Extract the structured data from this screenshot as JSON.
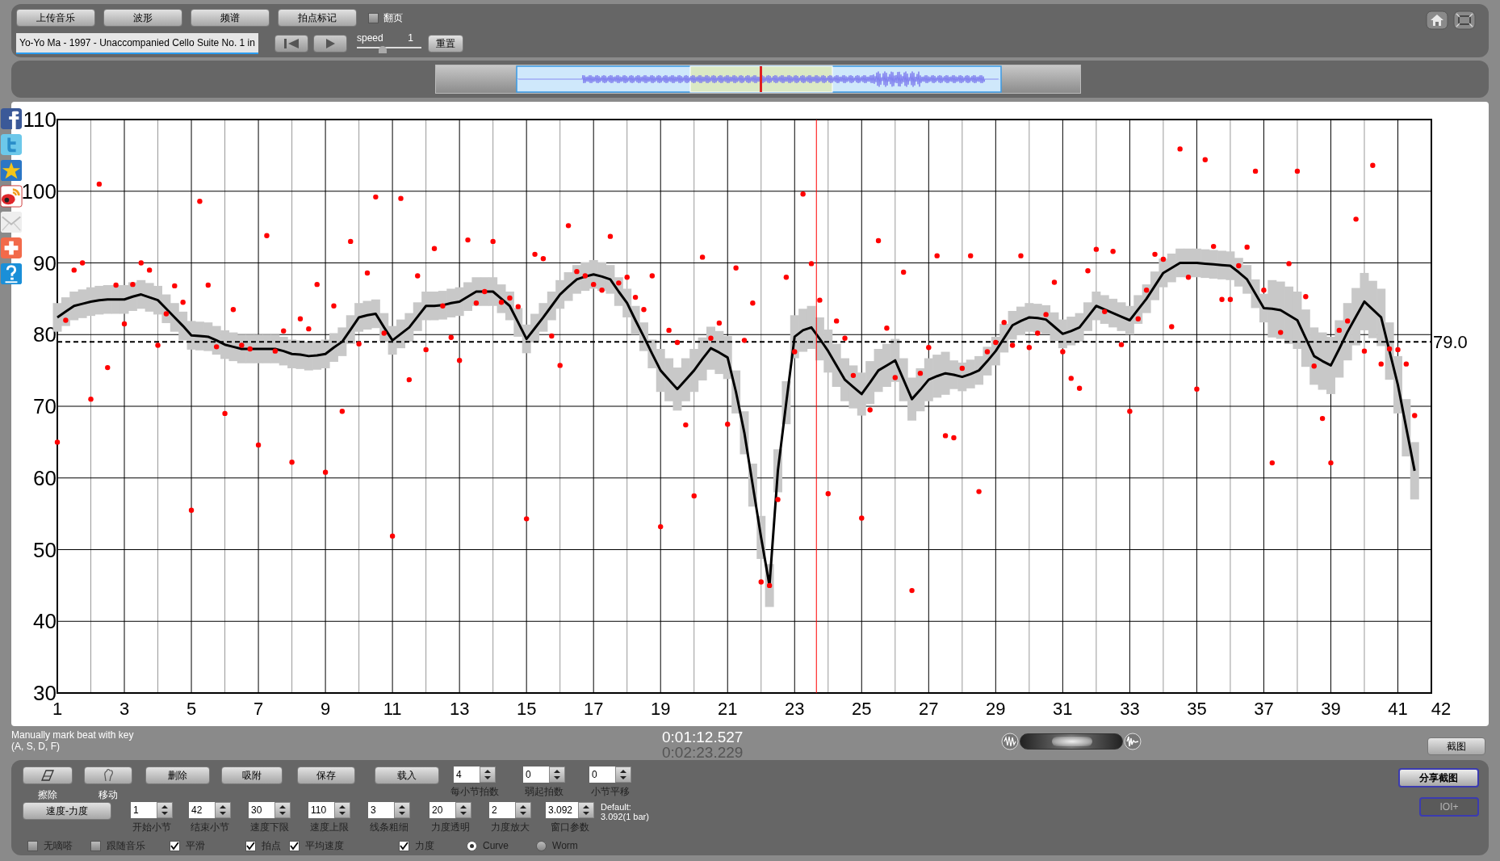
{
  "toolbar": {
    "buttons": [
      "上传音乐",
      "波形",
      "频谱",
      "拍点标记"
    ],
    "page_flip": {
      "label": "翻页",
      "checked": false
    }
  },
  "track": {
    "title": "Yo-Yo Ma - 1997 - Unaccompanied Cello Suite No. 1 in",
    "speed_label": "speed",
    "speed_value": "1",
    "level": 0.4,
    "reset": "重置"
  },
  "chart": {
    "chart_data": {
      "type": "scatter",
      "grid": true,
      "xlim": [
        1,
        42
      ],
      "ylim": [
        30,
        110
      ],
      "xticks": [
        1,
        3,
        5,
        7,
        9,
        11,
        13,
        15,
        17,
        19,
        21,
        23,
        25,
        27,
        29,
        31,
        33,
        35,
        37,
        39,
        41,
        42
      ],
      "yticks": [
        30,
        40,
        50,
        60,
        70,
        80,
        90,
        100,
        110
      ],
      "x": [
        1,
        1.25,
        1.5,
        1.75,
        2,
        2.25,
        2.5,
        2.75,
        3,
        3.25,
        3.5,
        3.75,
        4,
        4.25,
        4.5,
        4.75,
        5,
        5.25,
        5.5,
        5.75,
        6,
        6.25,
        6.5,
        6.75,
        7,
        7.25,
        7.5,
        7.75,
        8,
        8.25,
        8.5,
        8.75,
        9,
        9.25,
        9.5,
        9.75,
        10,
        10.25,
        10.5,
        10.75,
        11,
        11.25,
        11.5,
        11.75,
        12,
        12.25,
        12.5,
        12.75,
        13,
        13.25,
        13.5,
        13.75,
        14,
        14.25,
        14.5,
        14.75,
        15,
        15.25,
        15.5,
        15.75,
        16,
        16.25,
        16.5,
        16.75,
        17,
        17.25,
        17.5,
        17.75,
        18,
        18.25,
        18.5,
        18.75,
        19,
        19.25,
        19.5,
        19.75,
        20,
        20.25,
        20.5,
        20.75,
        21,
        21.25,
        21.5,
        21.75,
        22,
        22.25,
        22.5,
        22.75,
        23,
        23.25,
        23.5,
        23.75,
        24,
        24.25,
        24.5,
        24.75,
        25,
        25.25,
        25.5,
        25.75,
        26,
        26.25,
        26.5,
        26.75,
        27,
        27.25,
        27.5,
        27.75,
        28,
        28.25,
        28.5,
        28.75,
        29,
        29.25,
        29.5,
        29.75,
        30,
        30.25,
        30.5,
        30.75,
        31,
        31.25,
        31.5,
        31.75,
        32,
        32.25,
        32.5,
        32.75,
        33,
        33.25,
        33.5,
        33.75,
        34,
        34.25,
        34.5,
        34.75,
        35,
        35.25,
        35.5,
        35.75,
        36,
        36.25,
        36.5,
        36.75,
        37,
        37.25,
        37.5,
        37.75,
        38,
        38.25,
        38.5,
        38.75,
        39,
        39.25,
        39.5,
        39.75,
        40,
        40.25,
        40.5,
        40.75,
        41,
        41.25,
        41.5
      ],
      "series": [
        {
          "color": "#ff0000",
          "values": [
            65,
            82,
            89,
            90,
            71,
            101,
            75.4,
            86.9,
            81.5,
            87,
            90,
            89,
            78.5,
            82.9,
            86.8,
            84.5,
            55.5,
            98.6,
            86.9,
            78.3,
            69,
            83.5,
            78.5,
            78,
            64.6,
            93.8,
            77.7,
            80.5,
            62.2,
            82.2,
            80.8,
            87,
            60.8,
            84,
            69.3,
            93,
            78.7,
            88.6,
            99.2,
            80.2,
            51.9,
            99,
            73.7,
            88.2,
            77.9,
            92,
            84,
            79.6,
            76.4,
            93.2,
            84.4,
            86,
            93,
            84.5,
            85.1,
            83.9,
            54.3,
            91.2,
            90.6,
            79.8,
            75.7,
            95.2,
            88.8,
            88.2,
            87,
            86.2,
            93.7,
            87.2,
            88,
            85.2,
            83.5,
            88.2,
            53.2,
            80.6,
            78.9,
            67.4,
            57.5,
            90.8,
            79.5,
            81.6,
            67.5,
            89.3,
            79.2,
            84.4,
            45.5,
            45,
            57,
            88,
            77.6,
            99.6,
            89.9,
            84.8,
            57.8,
            81.9,
            79.5,
            74.3,
            54.4,
            69.5,
            93.1,
            80.9,
            74,
            88.7,
            44.3,
            74.6,
            78.2,
            91,
            65.9,
            65.6,
            75.3,
            91,
            58.1,
            77.6,
            78.9,
            81.7,
            78.5,
            91,
            78.2,
            80.2,
            82.8,
            87.3,
            77.6,
            73.9,
            72.5,
            88.9,
            91.9,
            83.2,
            91.6,
            78.6,
            69.3,
            82.2,
            86.2,
            91.2,
            90.5,
            81.1,
            105.9,
            88,
            72.4,
            104.4,
            92.3,
            84.9,
            84.9,
            89.6,
            92.2,
            102.8,
            86.2,
            62.1,
            80.3,
            89.9,
            102.8,
            85.3,
            75.6,
            68.3,
            62.1,
            80.6,
            81.9,
            96.1,
            77.7,
            103.6,
            75.9,
            78,
            77.9,
            75.9,
            68.7
          ]
        },
        {
          "type": "line",
          "color": "#000000",
          "errors": [
            2,
            2,
            2,
            2,
            2,
            2,
            2,
            2,
            2,
            2,
            2,
            2,
            2,
            2,
            2,
            2,
            2,
            2,
            2,
            2,
            2,
            2,
            2,
            2,
            2,
            2,
            2,
            2,
            2,
            2,
            2,
            2,
            2,
            2,
            2,
            2,
            2,
            2,
            2,
            2,
            2,
            2,
            2,
            2,
            2,
            2,
            2,
            2,
            2,
            2,
            2,
            2,
            2,
            2,
            2,
            2,
            2,
            2,
            2,
            2,
            2,
            2,
            2,
            2,
            2,
            2,
            2,
            2,
            2,
            2,
            2,
            2,
            3,
            3,
            3,
            3,
            3,
            3,
            3,
            3,
            3,
            3,
            3,
            3,
            3,
            3,
            3,
            3,
            3,
            3,
            3,
            3,
            3,
            3,
            3,
            3,
            3,
            3,
            3,
            3,
            3,
            3,
            3,
            3,
            3,
            3,
            3,
            2,
            2,
            2,
            2,
            2,
            2,
            2,
            2,
            2,
            2,
            2,
            2,
            2,
            2,
            2,
            2,
            2,
            2,
            2,
            2,
            2,
            2,
            2,
            2,
            2,
            2,
            2,
            2,
            2,
            2,
            2,
            2,
            2,
            2,
            2,
            2,
            2,
            2,
            4,
            4,
            4,
            4,
            4,
            4,
            4,
            4,
            4,
            4,
            4,
            4,
            4,
            4,
            4,
            4,
            4,
            4
          ],
          "values": [
            82.4,
            83.2,
            84,
            84.3,
            84.6,
            84.8,
            84.9,
            84.9,
            84.9,
            85.3,
            85.6,
            85.2,
            84.8,
            83.6,
            82.4,
            81.2,
            79.9,
            79.8,
            79.7,
            79.2,
            78.6,
            78.3,
            78,
            78,
            78,
            78,
            78,
            77.7,
            77.3,
            77.2,
            77,
            77.1,
            77.3,
            78.2,
            79,
            80.7,
            82.4,
            82.7,
            82.9,
            81,
            79.2,
            80.1,
            81,
            82.5,
            84,
            84,
            84.1,
            84.4,
            84.6,
            85.3,
            86,
            86,
            86,
            85,
            84,
            81.7,
            79.4,
            80.9,
            82.4,
            84,
            85.6,
            86.7,
            87.7,
            88.1,
            88.4,
            88.1,
            87.7,
            86,
            84.4,
            82,
            79.7,
            77.3,
            75,
            73.7,
            72.4,
            73.7,
            75,
            76.6,
            78.1,
            77.5,
            76.8,
            72,
            66.3,
            59,
            51.7,
            45,
            61,
            70.5,
            79.7,
            80.6,
            81,
            79.4,
            77.7,
            75.7,
            73.7,
            72.7,
            71.7,
            73.3,
            75,
            75.7,
            76.4,
            73.7,
            71,
            72.3,
            73.7,
            74.2,
            74.6,
            74.4,
            74.1,
            74.5,
            75,
            76.3,
            77.7,
            79.5,
            81.3,
            81.9,
            82.4,
            82.3,
            82.1,
            81.1,
            80.1,
            80.5,
            81,
            82.5,
            84,
            83.5,
            83,
            82.5,
            82,
            83.5,
            85,
            86.8,
            88.6,
            89.3,
            90,
            90,
            90,
            89.9,
            89.8,
            89.7,
            89.6,
            88.7,
            87.7,
            85.7,
            83.7,
            83.6,
            83.4,
            82.7,
            82,
            79.5,
            77,
            76.3,
            75.7,
            78,
            80.4,
            82.5,
            84.6,
            83.5,
            82.4,
            77.7,
            73,
            67,
            61
          ]
        }
      ],
      "ref_lines": [
        {
          "axis": "y",
          "value": 79,
          "label": "79.0"
        },
        {
          "axis": "x",
          "value": 23.65,
          "color": "#ff0000"
        }
      ]
    }
  },
  "zoom": {
    "level": 0.5
  },
  "hint": [
    "Manually mark beat with key",
    "(A, S, D, F)"
  ],
  "times": {
    "current": "0:01:12.527",
    "total": "0:02:23.229"
  },
  "screenshot_button": "截图",
  "tools": [
    {
      "kind": "eraser",
      "label": "擦除"
    },
    {
      "kind": "hand",
      "label": "移动"
    },
    {
      "kind": "text",
      "label": "删除"
    },
    {
      "kind": "text",
      "label": "吸附"
    },
    {
      "kind": "text",
      "label": "保存"
    },
    {
      "kind": "text",
      "label": "载入"
    }
  ],
  "row1_fields": [
    {
      "value": "4",
      "label": "每小节拍数"
    },
    {
      "value": "0",
      "label": "弱起拍数"
    },
    {
      "value": "0",
      "label": "小节平移"
    }
  ],
  "mode_button": "速度-力度",
  "row2_fields": [
    {
      "value": "1",
      "label": "开始小节"
    },
    {
      "value": "42",
      "label": "结束小节"
    },
    {
      "value": "30",
      "label": "速度下限"
    },
    {
      "value": "110",
      "label": "速度上限"
    },
    {
      "value": "3",
      "label": "线条粗细"
    },
    {
      "value": "20",
      "label": "力度透明"
    },
    {
      "value": "2",
      "label": "力度放大"
    },
    {
      "value": "3.092",
      "label": "窗口参数"
    }
  ],
  "default_note": [
    "Default:",
    "3.092(1 bar)"
  ],
  "options": [
    {
      "kind": "checkbox",
      "label": "无嘀嗒",
      "checked": false
    },
    {
      "kind": "checkbox",
      "label": "跟随音乐",
      "checked": false
    },
    {
      "kind": "checkbox",
      "label": "平滑",
      "checked": true
    },
    {
      "kind": "checkbox",
      "label": "拍点",
      "checked": true
    },
    {
      "kind": "checkbox",
      "label": "平均速度",
      "checked": true
    },
    {
      "kind": "checkbox",
      "label": "力度",
      "checked": true
    },
    {
      "kind": "radio",
      "label": "Curve",
      "selected": true
    },
    {
      "kind": "radio",
      "label": "Worm",
      "selected": false
    }
  ],
  "share_button": "分享截图",
  "ioi_button": {
    "label": "IOI+",
    "disabled": true
  }
}
